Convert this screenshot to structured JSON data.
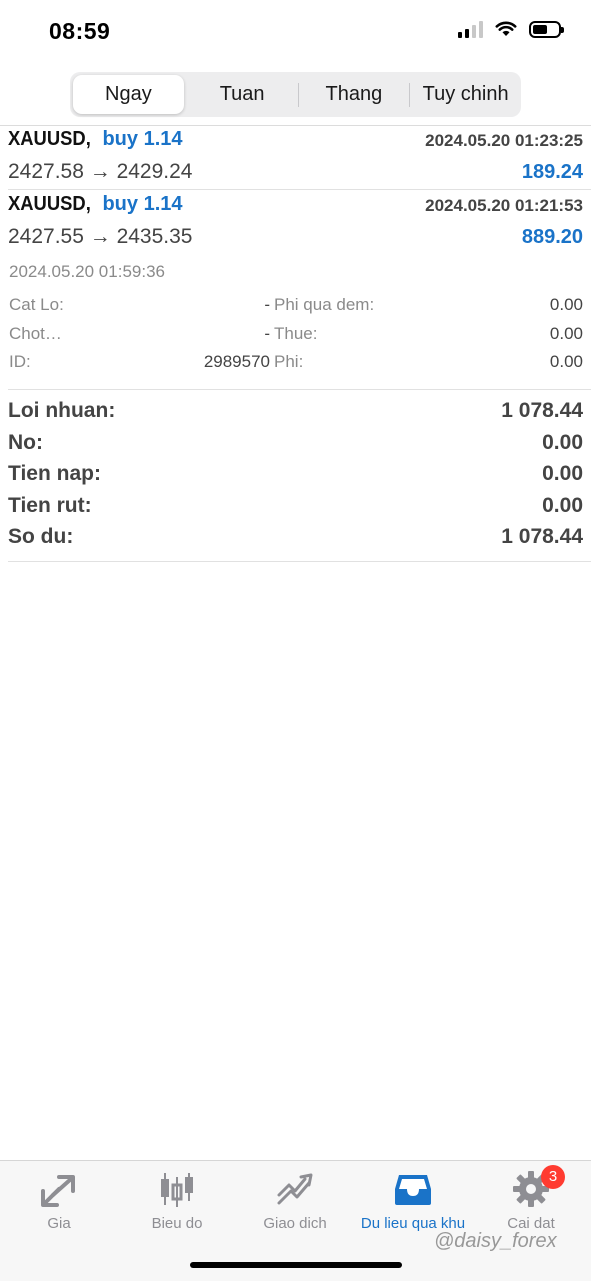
{
  "status_bar": {
    "time": "08:59"
  },
  "tabs": [
    "Ngay",
    "Tuan",
    "Thang",
    "Tuy chinh"
  ],
  "trades": [
    {
      "symbol": "XAUUSD,",
      "direction": "buy 1.14",
      "date": "2024.05.20 01:23:25",
      "prices": "2427.58 → 2429.24",
      "profit": "189.24"
    },
    {
      "symbol": "XAUUSD,",
      "direction": "buy 1.14",
      "date": "2024.05.20 01:21:53",
      "prices": "2427.55 → 2435.35",
      "profit": "889.20"
    }
  ],
  "details": {
    "close_date": "2024.05.20 01:59:36",
    "rows": [
      {
        "label": "Cat Lo:",
        "value": "-",
        "label2": "Phi qua dem:",
        "value2": "0.00"
      },
      {
        "label": "Chot…",
        "value": "-",
        "label2": "Thue:",
        "value2": "0.00"
      },
      {
        "label": "ID:",
        "value": "2989570",
        "label2": "Phi:",
        "value2": "0.00"
      }
    ]
  },
  "summary": [
    {
      "label": "Loi nhuan:",
      "value": "1 078.44"
    },
    {
      "label": "No:",
      "value": "0.00"
    },
    {
      "label": "Tien nap:",
      "value": "0.00"
    },
    {
      "label": "Tien rut:",
      "value": "0.00"
    },
    {
      "label": "So du:",
      "value": "1 078.44"
    }
  ],
  "tabbar": {
    "items": [
      {
        "label": "Gia",
        "icon": "price-arrows-icon"
      },
      {
        "label": "Bieu do",
        "icon": "candlestick-icon"
      },
      {
        "label": "Giao dich",
        "icon": "trade-chart-icon"
      },
      {
        "label": "Du lieu qua khu",
        "icon": "history-tray-icon"
      },
      {
        "label": "Cai dat",
        "icon": "gear-icon"
      }
    ],
    "badge": "3"
  },
  "watermark": "@daisy_forex",
  "colors": {
    "accent": "#1a73c8",
    "badge": "#ff3b30"
  }
}
